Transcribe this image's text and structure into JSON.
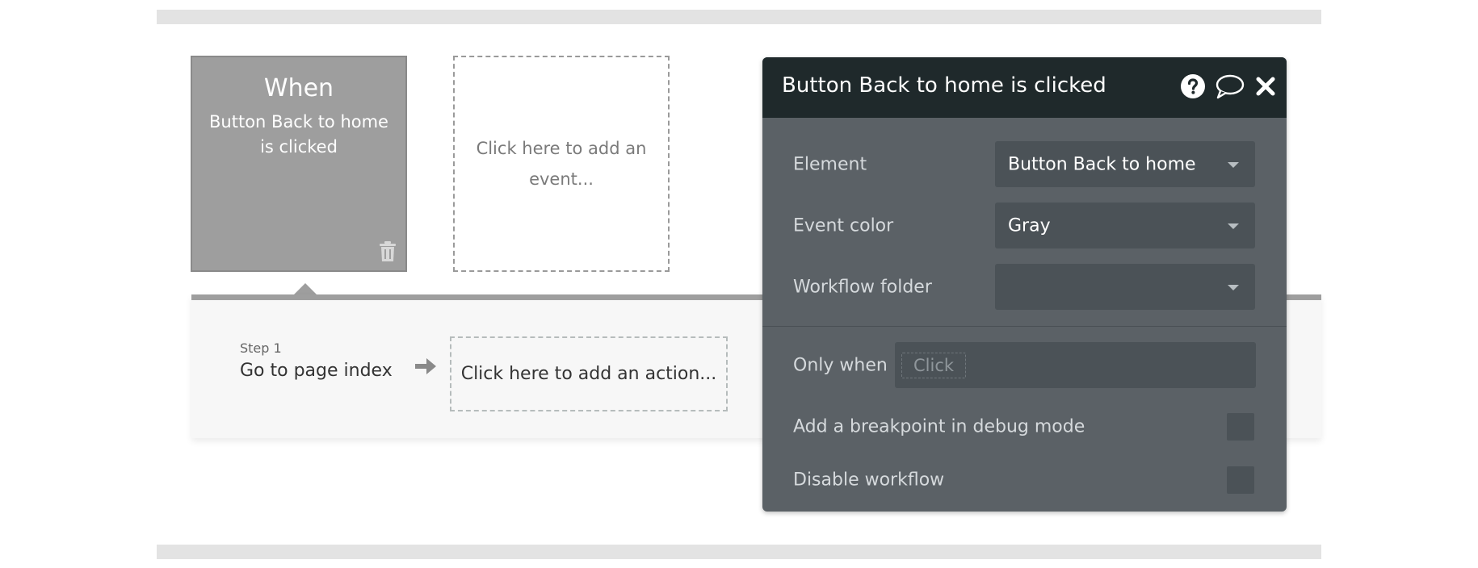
{
  "event_card": {
    "title": "When",
    "description": "Button Back to home is clicked"
  },
  "add_event": {
    "label": "Click here to add an event..."
  },
  "steps": [
    {
      "label": "Step 1",
      "action": "Go to page index"
    }
  ],
  "add_action": {
    "label": "Click here to add an action..."
  },
  "editor": {
    "title": "Button Back to home is clicked",
    "icons": [
      "help-icon",
      "comment-icon",
      "close-icon"
    ],
    "element": {
      "label": "Element",
      "value": "Button Back to home"
    },
    "event_color": {
      "label": "Event color",
      "value": "Gray"
    },
    "workflow_folder": {
      "label": "Workflow folder",
      "value": ""
    },
    "only_when": {
      "label": "Only when",
      "placeholder": "Click"
    },
    "breakpoint": {
      "label": "Add a breakpoint in debug mode"
    },
    "disable": {
      "label": "Disable workflow"
    }
  },
  "colors": {
    "event_card_bg": "#9e9e9e",
    "editor_bg": "#5b6166",
    "editor_header_bg": "#1f292b",
    "dropdown_bg": "#4b5257"
  }
}
